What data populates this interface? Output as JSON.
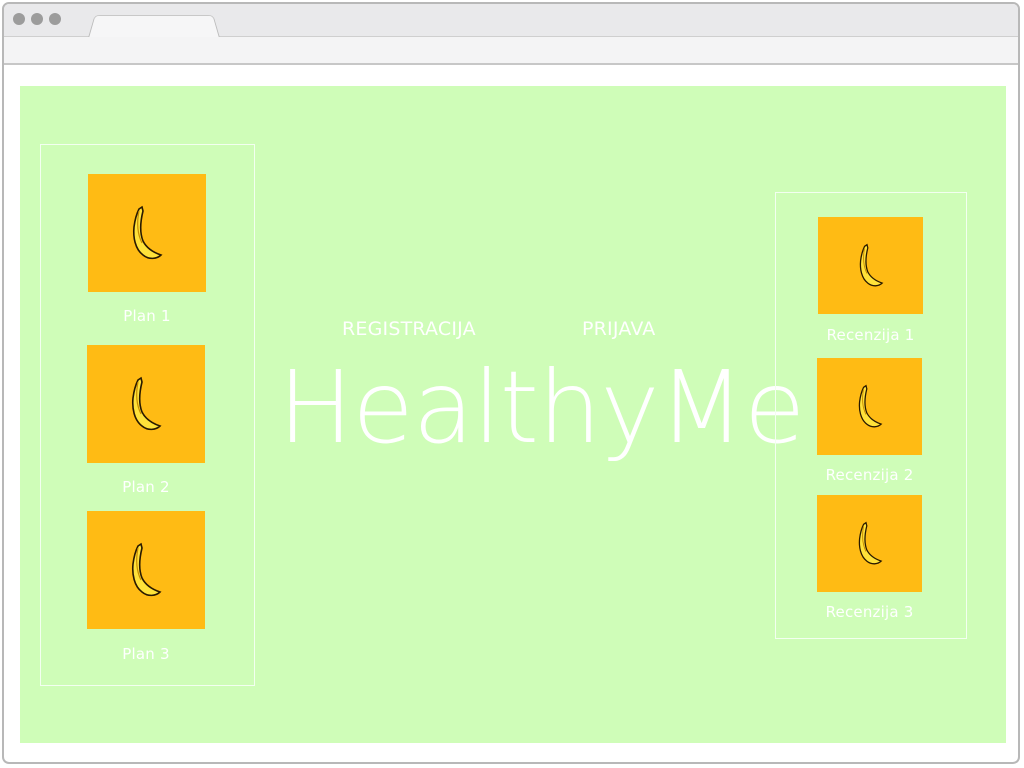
{
  "browser": {
    "tab_title": "",
    "address": ""
  },
  "colors": {
    "page_bg": "#cffdb8",
    "thumb_bg": "#ffbb14",
    "text": "#ffffff"
  },
  "nav": {
    "register_label": "REGISTRACIJA",
    "login_label": "PRIJAVA"
  },
  "brand": {
    "title": "HealthyMe"
  },
  "plans": [
    {
      "label": "Plan 1",
      "icon": "banana-icon"
    },
    {
      "label": "Plan 2",
      "icon": "banana-icon"
    },
    {
      "label": "Plan 3",
      "icon": "banana-icon"
    }
  ],
  "reviews": [
    {
      "label": "Recenzija 1",
      "icon": "banana-icon"
    },
    {
      "label": "Recenzija 2",
      "icon": "banana-icon"
    },
    {
      "label": "Recenzija 3",
      "icon": "banana-icon"
    }
  ]
}
